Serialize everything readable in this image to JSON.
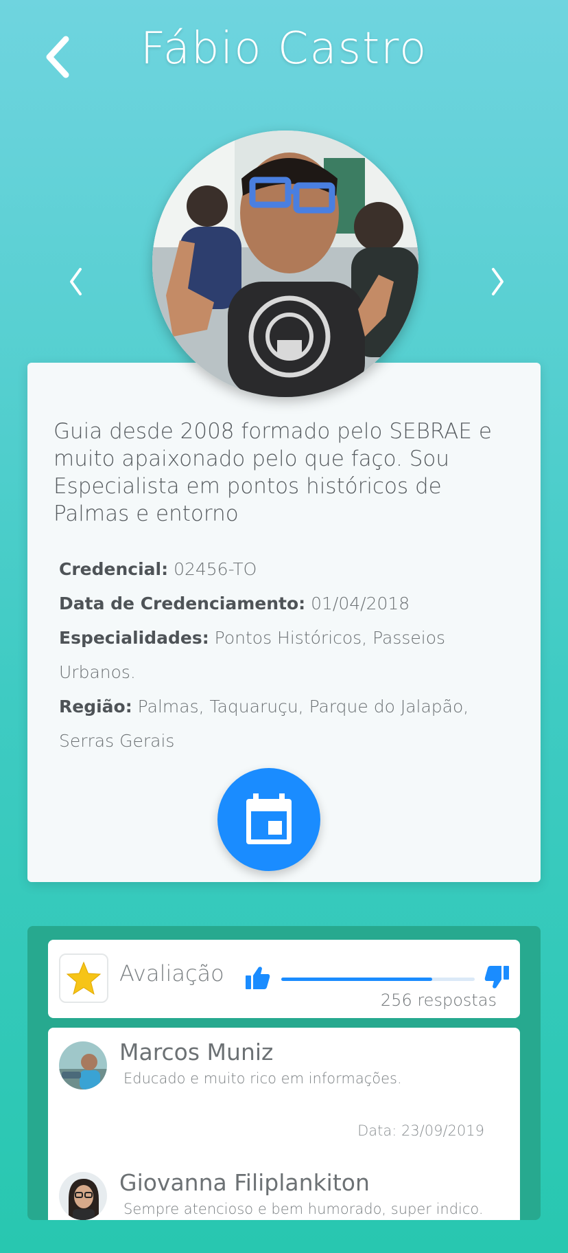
{
  "header": {
    "title": "Fábio Castro"
  },
  "profile": {
    "bio": "Guia desde 2008 formado pelo SEBRAE e muito apaixonado pelo que faço. Sou Especialista em pontos históricos de Palmas e entorno",
    "details": [
      {
        "label": "Credencial:",
        "value": "02456-TO"
      },
      {
        "label": "Data de Credenciamento:",
        "value": "01/04/2018"
      },
      {
        "label": "Especialidades:",
        "value": "Pontos Históricos, Passeios Urbanos."
      },
      {
        "label": "Região:",
        "value": "Palmas, Taquaruçu, Parque do Jalapão, Serras Gerais"
      }
    ]
  },
  "rating": {
    "label": "Avaliação",
    "responses": "256 respostas",
    "positive_fraction": 0.78
  },
  "comments": [
    {
      "name": "Marcos Muniz",
      "text": "Educado e muito rico em informações.",
      "date": "Data: 23/09/2019"
    },
    {
      "name": "Giovanna Filiplankiton",
      "text": "Sempre atencioso e bem humorado, super indico."
    }
  ],
  "colors": {
    "accent": "#1a8cff",
    "panel": "#27a98f",
    "star": "#f6c417"
  },
  "icons": {
    "back": "chevron-left-icon",
    "prev": "chevron-left-icon",
    "next": "chevron-right-icon",
    "calendar": "calendar-icon",
    "star": "star-icon",
    "thumb_up": "thumbs-up-icon",
    "thumb_down": "thumbs-down-icon"
  }
}
